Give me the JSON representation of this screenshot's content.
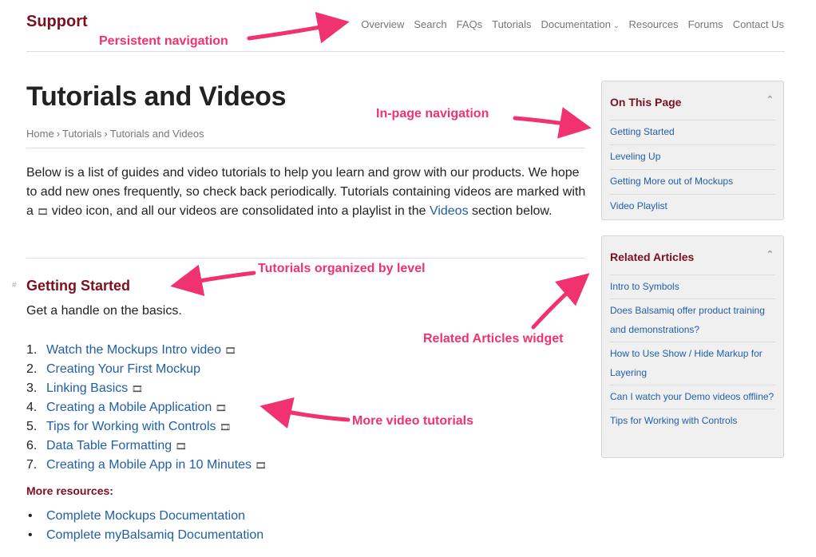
{
  "header": {
    "brand": "Support",
    "nav": [
      "Overview",
      "Search",
      "FAQs",
      "Tutorials",
      "Documentation",
      "Resources",
      "Forums",
      "Contact Us"
    ]
  },
  "page": {
    "title": "Tutorials and Videos",
    "breadcrumb": [
      "Home",
      "Tutorials",
      "Tutorials and Videos"
    ],
    "intro_1": "Below is a list of guides and video tutorials to help you learn and grow with our products. We hope to add new ones frequently, so check back periodically. Tutorials containing videos are marked with a ",
    "intro_2": " video icon, and all our videos are consolidated into a playlist in the ",
    "intro_link": "Videos",
    "intro_3": " section below.",
    "section_title": "Getting Started",
    "section_anchor": "#",
    "section_sub": "Get a handle on the basics.",
    "tutorials": [
      {
        "num": "1.",
        "label": "Watch the Mockups Intro video",
        "video": true
      },
      {
        "num": "2.",
        "label": "Creating Your First Mockup",
        "video": false
      },
      {
        "num": "3.",
        "label": "Linking Basics",
        "video": true
      },
      {
        "num": "4.",
        "label": "Creating a Mobile Application",
        "video": true
      },
      {
        "num": "5.",
        "label": "Tips for Working with Controls",
        "video": true
      },
      {
        "num": "6.",
        "label": "Data Table Formatting",
        "video": true
      },
      {
        "num": "7.",
        "label": "Creating a Mobile App in 10 Minutes",
        "video": true
      }
    ],
    "more_title": "More resources:",
    "resources": [
      "Complete Mockups Documentation",
      "Complete myBalsamiq Documentation"
    ]
  },
  "sidebar": {
    "on_this_page": {
      "title": "On This Page",
      "items": [
        "Getting Started",
        "Leveling Up",
        "Getting More out of Mockups",
        "Video Playlist"
      ]
    },
    "related": {
      "title": "Related Articles",
      "items": [
        "Intro to Symbols",
        "Does Balsamiq offer product training and demonstrations?",
        "How to Use Show / Hide Markup for Layering",
        "Can I watch your Demo videos offline?",
        "Tips for Working with Controls"
      ]
    }
  },
  "annotations": {
    "persistent_nav": "Persistent navigation",
    "in_page_nav": "In-page navigation",
    "organized": "Tutorials organized by level",
    "related_widget": "Related Articles widget",
    "more_video": "More video tutorials"
  },
  "icons": {
    "video": "film-icon",
    "collapse": "chevron-up-icon",
    "dropdown": "chevron-down-icon"
  },
  "colors": {
    "brand": "#7a1020",
    "link": "#1f5fa8",
    "annotation": "#f0336e"
  }
}
